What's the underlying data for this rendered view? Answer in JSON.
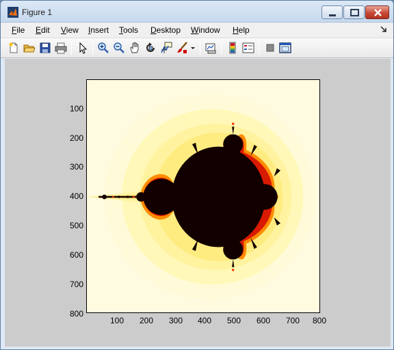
{
  "window": {
    "title": "Figure 1"
  },
  "menu": {
    "items": [
      {
        "label": "File",
        "mnemonic": "F",
        "rest": "ile"
      },
      {
        "label": "Edit",
        "mnemonic": "E",
        "rest": "dit"
      },
      {
        "label": "View",
        "mnemonic": "V",
        "rest": "iew"
      },
      {
        "label": "Insert",
        "mnemonic": "I",
        "rest": "nsert"
      },
      {
        "label": "Tools",
        "mnemonic": "T",
        "rest": "ools"
      },
      {
        "label": "Desktop",
        "mnemonic": "D",
        "rest": "esktop"
      },
      {
        "label": "Window",
        "mnemonic": "W",
        "rest": "indow"
      },
      {
        "label": "Help",
        "mnemonic": "H",
        "rest": "elp"
      }
    ]
  },
  "toolbar": {
    "icons": [
      "new-figure-icon",
      "open-file-icon",
      "save-figure-icon",
      "print-figure-icon",
      "edit-plot-arrow-icon",
      "zoom-in-icon",
      "zoom-out-icon",
      "pan-hand-icon",
      "rotate-3d-icon",
      "data-cursor-icon",
      "brush-icon",
      "brush-dropdown-icon",
      "link-plot-icon",
      "insert-colorbar-icon",
      "insert-legend-icon",
      "hide-plot-tools-icon",
      "show-plot-tools-icon"
    ]
  },
  "plot": {
    "yticks": [
      "100",
      "200",
      "300",
      "400",
      "500",
      "600",
      "700",
      "800"
    ],
    "xticks": [
      "100",
      "200",
      "300",
      "400",
      "500",
      "600",
      "700",
      "800"
    ],
    "colors": {
      "set": "#120000",
      "edge_red": "#e01500",
      "edge_orange": "#ff9900",
      "glow": "#ffff66",
      "outer": "#fffbe0",
      "corner": "#ffffff",
      "figure_bg": "#cccccc"
    }
  }
}
